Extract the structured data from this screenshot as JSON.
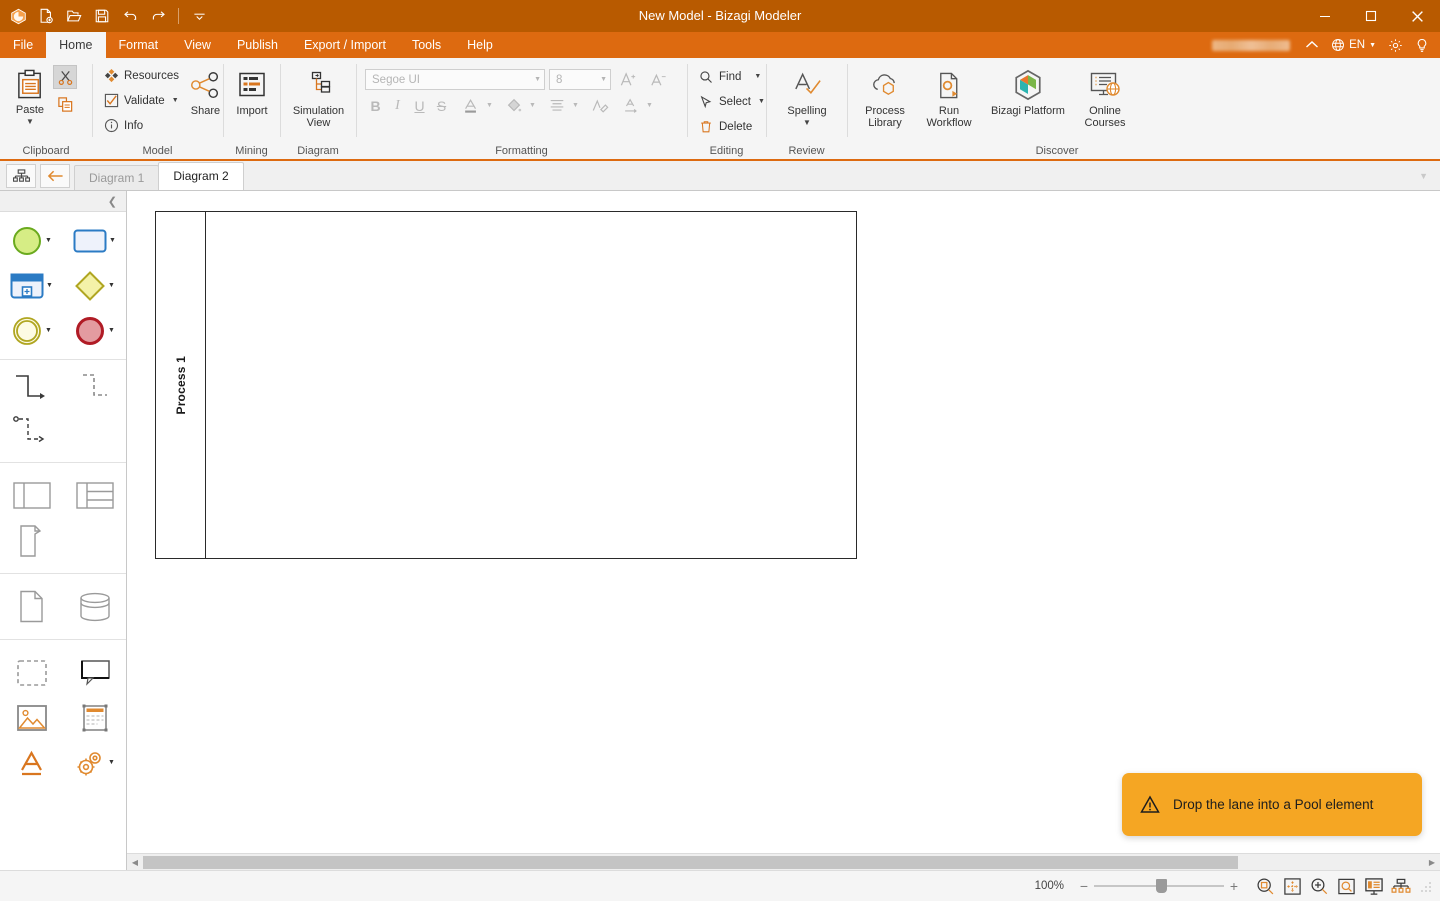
{
  "window": {
    "title": "New Model - Bizagi Modeler",
    "app_icon": "bizagi-hexagon-icon",
    "minimize": "minimize-icon",
    "maximize": "maximize-icon",
    "close": "close-icon",
    "accent": "#dd6a10",
    "titlebar_bg": "#b85a00"
  },
  "quick_access": [
    {
      "name": "new-document-icon",
      "label": "New"
    },
    {
      "name": "open-folder-icon",
      "label": "Open"
    },
    {
      "name": "save-icon",
      "label": "Save"
    },
    {
      "name": "undo-icon",
      "label": "Undo"
    },
    {
      "name": "redo-icon",
      "label": "Redo"
    },
    {
      "name": "customize-qat-icon",
      "label": "Customize Quick Access Toolbar"
    }
  ],
  "ribbon_tabs": [
    {
      "label": "File",
      "active": false
    },
    {
      "label": "Home",
      "active": true
    },
    {
      "label": "Format",
      "active": false
    },
    {
      "label": "View",
      "active": false
    },
    {
      "label": "Publish",
      "active": false
    },
    {
      "label": "Export / Import",
      "active": false
    },
    {
      "label": "Tools",
      "active": false
    },
    {
      "label": "Help",
      "active": false
    }
  ],
  "ribbon_right": {
    "account_redacted": "",
    "collapse_label": "",
    "language": "EN",
    "settings_icon": "gear-icon",
    "help_icon": "lightbulb-icon"
  },
  "ribbon": {
    "clipboard": {
      "group_label": "Clipboard",
      "paste_label": "Paste",
      "cut_label": "Cut",
      "copy_label": "Copy"
    },
    "model": {
      "group_label": "Model",
      "resources_label": "Resources",
      "validate_label": "Validate",
      "info_label": "Info",
      "share_label": "Share"
    },
    "mining": {
      "group_label": "Mining",
      "import_label": "Import"
    },
    "diagram": {
      "group_label": "Diagram",
      "simulation_label_line1": "Simulation",
      "simulation_label_line2": "View"
    },
    "formatting": {
      "group_label": "Formatting",
      "font_family": "Segoe UI",
      "font_size": "8",
      "grow_font_label": "Grow Font",
      "shrink_font_label": "Shrink Font",
      "bold_label": "B",
      "italic_label": "I",
      "underline_label": "U",
      "strikethrough_label": "S",
      "font_color_label": "A",
      "fill_color_label": "Fill Color",
      "align_label": "Align",
      "format_painter_label": "Format Painter",
      "text_direction_label": "A"
    },
    "editing": {
      "group_label": "Editing",
      "find_label": "Find",
      "select_label": "Select",
      "delete_label": "Delete"
    },
    "review": {
      "group_label": "Review",
      "spelling_label": "Spelling"
    },
    "discover": {
      "group_label": "Discover",
      "process_library_line1": "Process",
      "process_library_line2": "Library",
      "run_workflow_line1": "Run",
      "run_workflow_line2": "Workflow",
      "bizagi_platform_label": "Bizagi Platform",
      "online_courses_line1": "Online",
      "online_courses_line2": "Courses"
    }
  },
  "tabstrip": {
    "tree_button": "diagram-tree-icon",
    "back_button": "back-arrow-icon",
    "tabs": [
      {
        "label": "Diagram 1",
        "active": false
      },
      {
        "label": "Diagram 2",
        "active": true
      }
    ],
    "collapse_icon": "chevron-down-icon"
  },
  "palette": {
    "collapse_icon": "chevron-left-icon",
    "sections": [
      {
        "name": "events-activities",
        "rows": [
          [
            {
              "name": "start-event-shape",
              "caret": true
            },
            {
              "name": "task-shape",
              "caret": true
            }
          ],
          [
            {
              "name": "subprocess-shape",
              "caret": true
            },
            {
              "name": "gateway-shape",
              "caret": true
            }
          ],
          [
            {
              "name": "intermediate-event-shape",
              "caret": true
            },
            {
              "name": "end-event-shape",
              "caret": true
            }
          ]
        ]
      },
      {
        "name": "connectors",
        "rows": [
          [
            {
              "name": "sequence-flow-connector",
              "caret": false
            },
            {
              "name": "message-flow-connector",
              "caret": false
            }
          ],
          [
            {
              "name": "association-connector",
              "caret": false
            },
            {
              "name": "empty-slot",
              "caret": false
            }
          ]
        ]
      },
      {
        "name": "swimlanes",
        "rows": [
          [
            {
              "name": "pool-shape",
              "caret": false
            },
            {
              "name": "lane-shape",
              "caret": false
            }
          ],
          [
            {
              "name": "milestone-shape",
              "caret": false
            },
            {
              "name": "empty-slot",
              "caret": false
            }
          ]
        ]
      },
      {
        "name": "artifacts-data",
        "rows": [
          [
            {
              "name": "data-object-shape",
              "caret": false
            },
            {
              "name": "data-store-shape",
              "caret": false
            }
          ]
        ]
      },
      {
        "name": "annotations",
        "rows": [
          [
            {
              "name": "group-shape",
              "caret": false
            },
            {
              "name": "annotation-shape",
              "caret": false
            }
          ],
          [
            {
              "name": "image-shape",
              "caret": false
            },
            {
              "name": "header-shape",
              "caret": false
            }
          ],
          [
            {
              "name": "text-shape",
              "caret": false
            },
            {
              "name": "extensions-shape",
              "caret": true
            }
          ]
        ]
      }
    ]
  },
  "canvas": {
    "pool": {
      "lane_label": "Process 1"
    },
    "hscroll": {
      "left_arrow": "scroll-left-arrow-icon",
      "right_arrow": "scroll-right-arrow-icon"
    }
  },
  "toast": {
    "icon": "warning-triangle-icon",
    "message": "Drop the lane into a Pool element",
    "bg": "#f5a623"
  },
  "statusbar": {
    "zoom_percent": "100%",
    "zoom_out_label": "−",
    "zoom_in_label": "+",
    "buttons": [
      {
        "name": "zoom-to-selection-icon",
        "label": "Zoom to selection"
      },
      {
        "name": "fit-to-window-icon",
        "label": "Fit to window"
      },
      {
        "name": "zoom-in-icon",
        "label": "Zoom in"
      },
      {
        "name": "zoom-region-icon",
        "label": "Zoom region"
      },
      {
        "name": "presentation-view-icon",
        "label": "Presentation view"
      },
      {
        "name": "diagram-tree-view-icon",
        "label": "Diagram tree view"
      }
    ],
    "resize_grip": "resize-grip-icon"
  }
}
